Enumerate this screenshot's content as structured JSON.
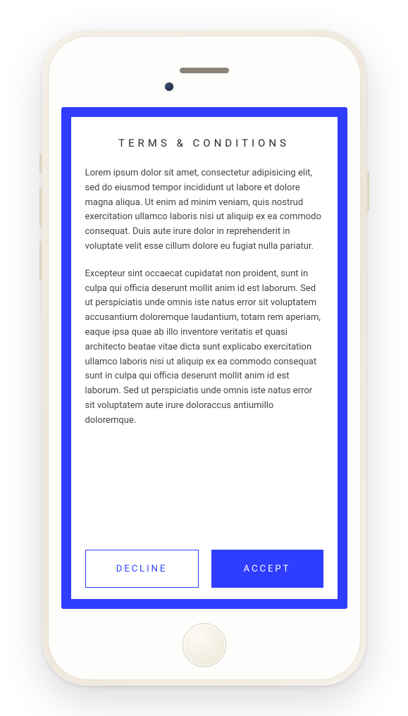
{
  "colors": {
    "accent": "#2e3dff"
  },
  "dialog": {
    "title": "TERMS & CONDITIONS",
    "paragraph1": "Lorem ipsum dolor sit amet, consectetur adipisicing elit, sed do eiusmod tempor incididunt ut labore et dolore magna aliqua. Ut enim ad minim veniam, quis nostrud exercitation ullamco laboris nisi ut aliquip ex ea commodo consequat. Duis aute irure dolor in reprehenderit in voluptate velit esse cillum dolore eu fugiat nulla pariatur.",
    "paragraph2": "Excepteur sint occaecat cupidatat non proident, sunt in culpa qui officia deserunt mollit anim id est laborum. Sed ut perspiciatis unde omnis iste natus error sit voluptatem accusantium doloremque laudantium, totam rem aperiam, eaque ipsa quae ab illo inventore veritatis et quasi architecto beatae vitae dicta sunt explicabo exercitation ullamco laboris nisi ut aliquip ex ea commodo consequat sunt in culpa qui officia deserunt mollit anim id est laborum. Sed ut perspiciatis unde omnis iste natus error sit voluptatem aute irure doloraccus antiumillo doloremque.",
    "decline_label": "DECLINE",
    "accept_label": "ACCEPT"
  }
}
